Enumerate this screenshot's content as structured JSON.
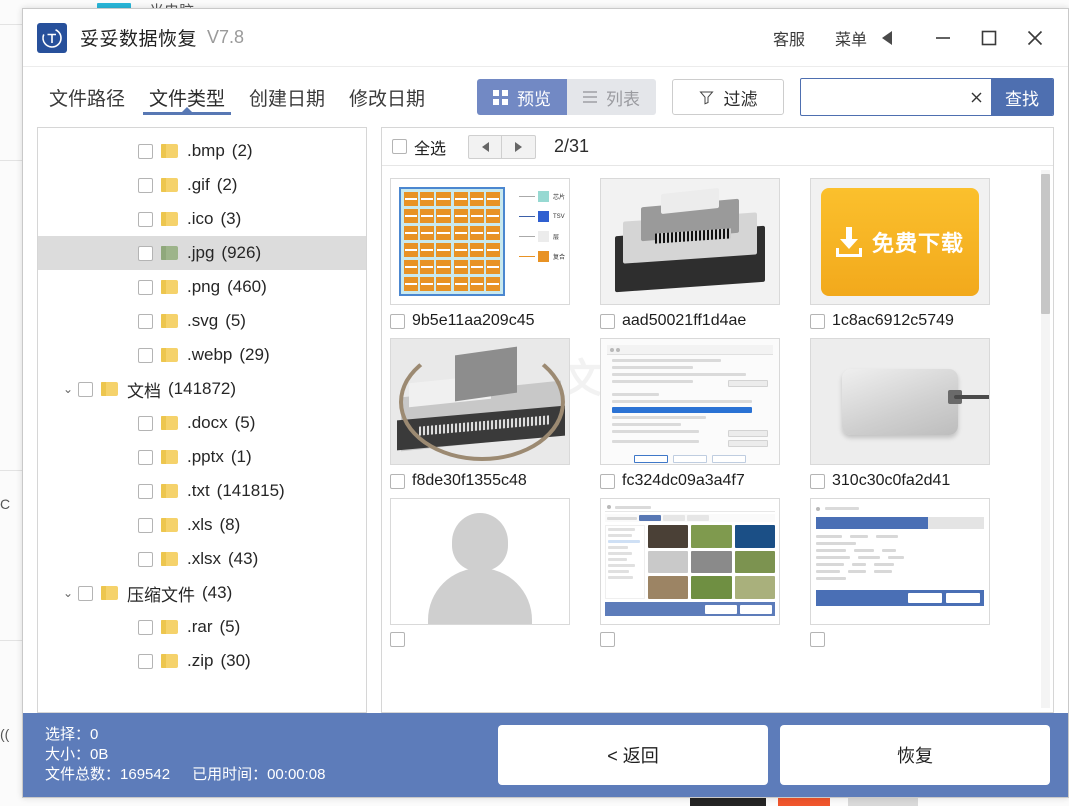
{
  "window": {
    "app_title": "妥妥数据恢复",
    "version": "V7.8",
    "logo_text": "T",
    "support_label": "客服",
    "menu_label": "菜单",
    "minimize_icon": "minimize-icon",
    "maximize_icon": "maximize-icon",
    "close_icon": "close-icon"
  },
  "tabs": [
    {
      "label": "文件路径",
      "active": false
    },
    {
      "label": "文件类型",
      "active": true
    },
    {
      "label": "创建日期",
      "active": false
    },
    {
      "label": "修改日期",
      "active": false
    }
  ],
  "toolbar": {
    "preview_label": "预览",
    "list_label": "列表",
    "filter_label": "过滤",
    "search_value": "",
    "search_placeholder": "",
    "search_clear_icon": "close-icon",
    "search_button_label": "查找"
  },
  "tree": {
    "items": [
      {
        "label": ".bmp",
        "count": "(2)",
        "level": 2,
        "caret": "",
        "selected": false,
        "folder": "yellow"
      },
      {
        "label": ".gif",
        "count": "(2)",
        "level": 2,
        "caret": "",
        "selected": false,
        "folder": "yellow"
      },
      {
        "label": ".ico",
        "count": "(3)",
        "level": 2,
        "caret": "",
        "selected": false,
        "folder": "yellow"
      },
      {
        "label": ".jpg",
        "count": "(926)",
        "level": 2,
        "caret": "",
        "selected": true,
        "folder": "green"
      },
      {
        "label": ".png",
        "count": "(460)",
        "level": 2,
        "caret": "",
        "selected": false,
        "folder": "yellow"
      },
      {
        "label": ".svg",
        "count": "(5)",
        "level": 2,
        "caret": "",
        "selected": false,
        "folder": "yellow"
      },
      {
        "label": ".webp",
        "count": "(29)",
        "level": 2,
        "caret": "",
        "selected": false,
        "folder": "yellow"
      },
      {
        "label": "文档",
        "count": "(141872)",
        "level": 1,
        "caret": "⌄",
        "selected": false,
        "folder": "yellow"
      },
      {
        "label": ".docx",
        "count": "(5)",
        "level": 2,
        "caret": "",
        "selected": false,
        "folder": "yellow"
      },
      {
        "label": ".pptx",
        "count": "(1)",
        "level": 2,
        "caret": "",
        "selected": false,
        "folder": "yellow"
      },
      {
        "label": ".txt",
        "count": "(141815)",
        "level": 2,
        "caret": "",
        "selected": false,
        "folder": "yellow"
      },
      {
        "label": ".xls",
        "count": "(8)",
        "level": 2,
        "caret": "",
        "selected": false,
        "folder": "yellow"
      },
      {
        "label": ".xlsx",
        "count": "(43)",
        "level": 2,
        "caret": "",
        "selected": false,
        "folder": "yellow"
      },
      {
        "label": "压缩文件",
        "count": "(43)",
        "level": 1,
        "caret": "⌄",
        "selected": false,
        "folder": "yellow"
      },
      {
        "label": ".rar",
        "count": "(5)",
        "level": 2,
        "caret": "",
        "selected": false,
        "folder": "yellow"
      },
      {
        "label": ".zip",
        "count": "(30)",
        "level": 2,
        "caret": "",
        "selected": false,
        "folder": "yellow"
      }
    ]
  },
  "grid": {
    "select_all_label": "全选",
    "prev_icon": "triangle-left-icon",
    "next_icon": "triangle-right-icon",
    "page_indicator": "2/31",
    "watermark": "恢复文件",
    "files": [
      {
        "name": "9b5e11aa209c45",
        "art": "diagram"
      },
      {
        "name": "aad50021ff1d4ae",
        "art": "hdd"
      },
      {
        "name": "1c8ac6912c5749",
        "art": "banner"
      },
      {
        "name": "f8de30f1355c48",
        "art": "conn"
      },
      {
        "name": "fc324dc09a3a4f7",
        "art": "dlg"
      },
      {
        "name": "310c30c0fa2d41",
        "art": "ssd"
      },
      {
        "name": "",
        "art": "avatar"
      },
      {
        "name": "",
        "art": "app"
      },
      {
        "name": "",
        "art": "wiz"
      }
    ],
    "banner_text": "免费下载"
  },
  "status": {
    "selected_label": "选择：",
    "selected_value": "0",
    "size_label": "大小：",
    "size_value": "0B",
    "total_label": "文件总数：",
    "total_value": "169542",
    "elapsed_label": "已用时间：",
    "elapsed_value": "00:00:08"
  },
  "actions": {
    "back_label": "< 返回",
    "recover_label": "恢复"
  },
  "colors": {
    "accent": "#5d7cba",
    "accent_strong": "#4e6fb0",
    "preview_active": "#7289c4",
    "folder_yellow": "#f5d26b",
    "folder_green": "#9db48a",
    "banner_yellow": "#f2a91c"
  }
}
